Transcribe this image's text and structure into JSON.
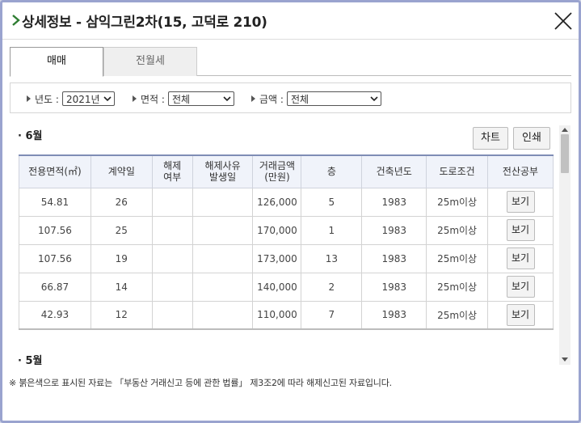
{
  "window": {
    "title": "상세정보 - 삼익그린2차(15, 고덕로 210)",
    "icons": {
      "title": "chevron-right-icon",
      "close": "close-icon"
    }
  },
  "tabs": [
    {
      "label": "매매",
      "active": true
    },
    {
      "label": "전월세",
      "active": false
    }
  ],
  "filters": {
    "year": {
      "label": "년도 :",
      "value": "2021년"
    },
    "area": {
      "label": "면적 :",
      "value": "전체"
    },
    "price": {
      "label": "금액 :",
      "value": "전체"
    }
  },
  "actions": {
    "chart": "차트",
    "print": "인쇄"
  },
  "sections": [
    {
      "month": "· 6월"
    },
    {
      "month": "· 5월"
    }
  ],
  "table": {
    "headers": [
      "전용면적(㎡)",
      "계약일",
      "해제\n여부",
      "해제사유\n발생일",
      "거래금액\n(만원)",
      "층",
      "건축년도",
      "도로조건",
      "전산공부"
    ],
    "rows": [
      {
        "area": "54.81",
        "day": "26",
        "cancel": "",
        "cancel_date": "",
        "price": "126,000",
        "floor": "5",
        "built": "1983",
        "road": "25m이상",
        "doc": "보기"
      },
      {
        "area": "107.56",
        "day": "25",
        "cancel": "",
        "cancel_date": "",
        "price": "170,000",
        "floor": "1",
        "built": "1983",
        "road": "25m이상",
        "doc": "보기"
      },
      {
        "area": "107.56",
        "day": "19",
        "cancel": "",
        "cancel_date": "",
        "price": "173,000",
        "floor": "13",
        "built": "1983",
        "road": "25m이상",
        "doc": "보기"
      },
      {
        "area": "66.87",
        "day": "14",
        "cancel": "",
        "cancel_date": "",
        "price": "140,000",
        "floor": "2",
        "built": "1983",
        "road": "25m이상",
        "doc": "보기"
      },
      {
        "area": "42.93",
        "day": "12",
        "cancel": "",
        "cancel_date": "",
        "price": "110,000",
        "floor": "7",
        "built": "1983",
        "road": "25m이상",
        "doc": "보기"
      }
    ]
  },
  "footnote": "※ 붉은색으로 표시된 자료는 「부동산 거래신고 등에 관한 법률」 제3조2에 따라 해제신고된 자료입니다.",
  "colors": {
    "window_border": "#9aa3cf",
    "header_bg": "#f0f3fa",
    "header_top_border": "#7f8db5",
    "title_chevron": "#2e7d32"
  }
}
